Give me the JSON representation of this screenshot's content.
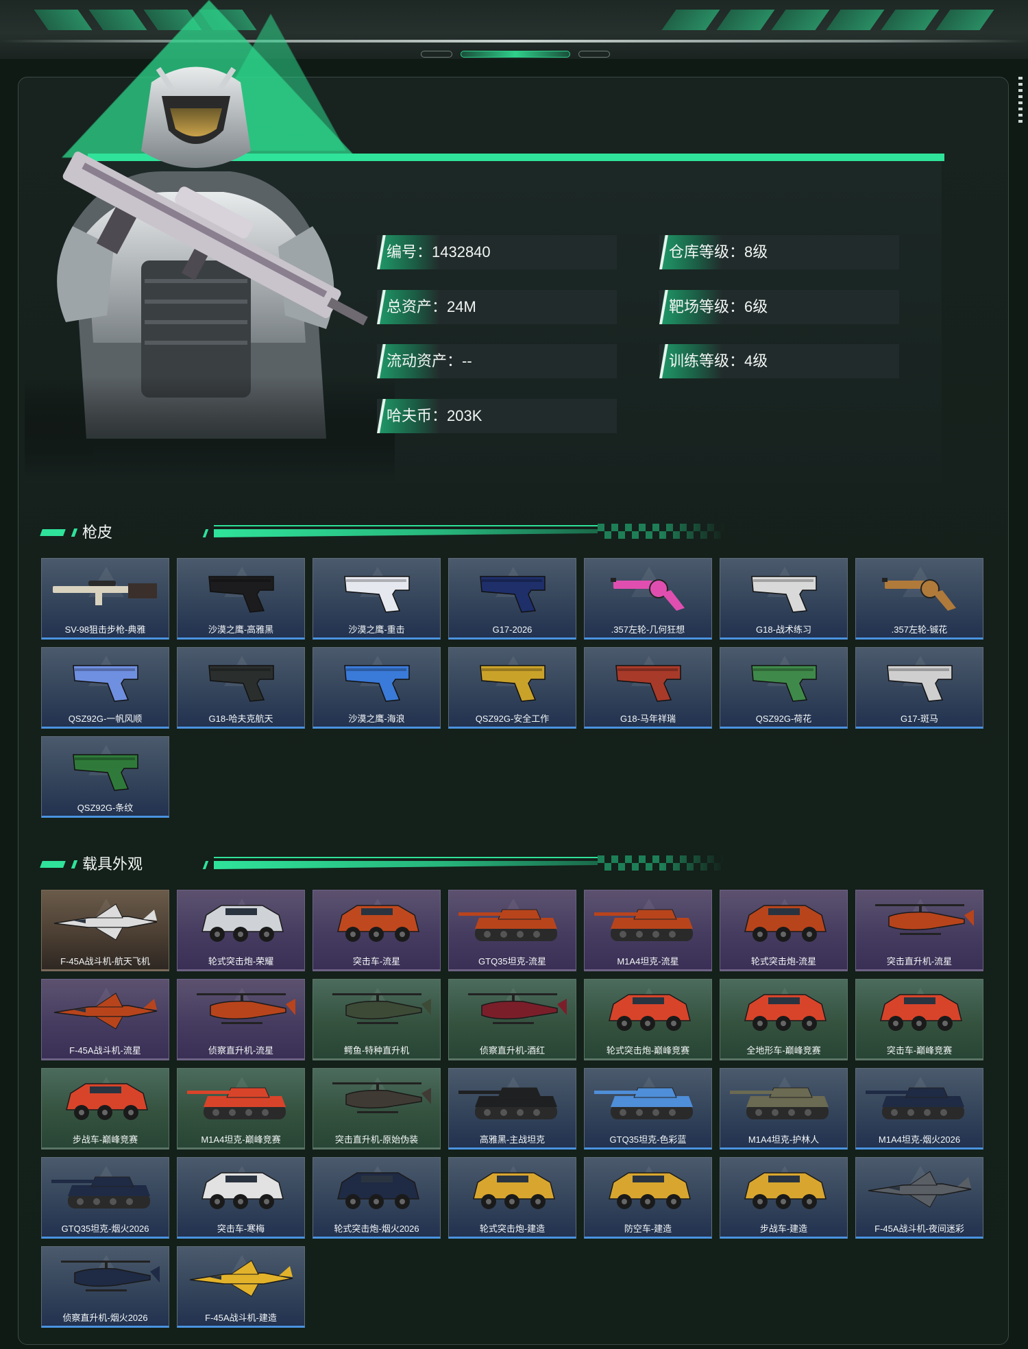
{
  "profile": {
    "stats": [
      {
        "text": "编号：1432840"
      },
      {
        "text": "仓库等级：8级"
      },
      {
        "text": "总资产：24M"
      },
      {
        "text": "靶场等级：6级"
      },
      {
        "text": "流动资产：--"
      },
      {
        "text": "训练等级：4级"
      },
      {
        "text": "哈夫币：203K"
      }
    ]
  },
  "weapon_skins": {
    "title": "枪皮",
    "items": [
      {
        "label": "SV-98狙击步枪-典雅",
        "rarity": "blue",
        "kind": "rifle",
        "color": "#d9d2bf"
      },
      {
        "label": "沙漠之鹰-高雅黑",
        "rarity": "blue",
        "kind": "pistol",
        "color": "#1c1c1e"
      },
      {
        "label": "沙漠之鹰-重击",
        "rarity": "blue",
        "kind": "pistol",
        "color": "#e6e8f0"
      },
      {
        "label": "G17-2026",
        "rarity": "blue",
        "kind": "pistol",
        "color": "#1e2f6a"
      },
      {
        "label": ".357左轮-几何狂想",
        "rarity": "blue",
        "kind": "revolver",
        "color": "#e04fb0"
      },
      {
        "label": "G18-战术练习",
        "rarity": "blue",
        "kind": "pistol",
        "color": "#d9d9d9"
      },
      {
        "label": ".357左轮-铖花",
        "rarity": "blue",
        "kind": "revolver",
        "color": "#b07a3a"
      },
      {
        "label": "QSZ92G-一帆风顺",
        "rarity": "blue",
        "kind": "pistol",
        "color": "#6f8fe0"
      },
      {
        "label": "G18-哈夫克航天",
        "rarity": "blue",
        "kind": "pistol",
        "color": "#2a2f2e"
      },
      {
        "label": "沙漠之鹰-海浪",
        "rarity": "blue",
        "kind": "pistol",
        "color": "#3a7ad8"
      },
      {
        "label": "QSZ92G-安全工作",
        "rarity": "blue",
        "kind": "pistol",
        "color": "#c9a22a"
      },
      {
        "label": "G18-马年祥瑞",
        "rarity": "blue",
        "kind": "pistol",
        "color": "#a83a2a"
      },
      {
        "label": "QSZ92G-荷花",
        "rarity": "blue",
        "kind": "pistol",
        "color": "#3f8a4a"
      },
      {
        "label": "G17-斑马",
        "rarity": "blue",
        "kind": "pistol",
        "color": "#cfcfcf"
      },
      {
        "label": "QSZ92G-条纹",
        "rarity": "blue",
        "kind": "pistol",
        "color": "#2f7a3a"
      }
    ]
  },
  "vehicle_skins": {
    "title": "载具外观",
    "items": [
      {
        "label": "F-45A战斗机-航天飞机",
        "rarity": "orange",
        "kind": "jet",
        "color": "#dcdcdc"
      },
      {
        "label": "轮式突击炮-荣耀",
        "rarity": "purple",
        "kind": "car",
        "color": "#cfd3d8"
      },
      {
        "label": "突击车-流星",
        "rarity": "purple",
        "kind": "car",
        "color": "#c0481e"
      },
      {
        "label": "GTQ35坦克-流星",
        "rarity": "purple",
        "kind": "tank",
        "color": "#b8441c"
      },
      {
        "label": "M1A4坦克-流星",
        "rarity": "purple",
        "kind": "tank",
        "color": "#b8441c"
      },
      {
        "label": "轮式突击炮-流星",
        "rarity": "purple",
        "kind": "car",
        "color": "#b8441c"
      },
      {
        "label": "突击直升机-流星",
        "rarity": "purple",
        "kind": "heli",
        "color": "#b8441c"
      },
      {
        "label": "F-45A战斗机-流星",
        "rarity": "purple",
        "kind": "jet",
        "color": "#b8441c"
      },
      {
        "label": "侦察直升机-流星",
        "rarity": "purple",
        "kind": "heli",
        "color": "#b8441c"
      },
      {
        "label": "鳄鱼-特种直升机",
        "rarity": "green",
        "kind": "heli",
        "color": "#3c4a36"
      },
      {
        "label": "侦察直升机-酒红",
        "rarity": "green",
        "kind": "heli",
        "color": "#7a1f2a"
      },
      {
        "label": "轮式突击炮-巅峰竞赛",
        "rarity": "green",
        "kind": "car",
        "color": "#d8442a"
      },
      {
        "label": "全地形车-巅峰竞赛",
        "rarity": "green",
        "kind": "car",
        "color": "#d8442a"
      },
      {
        "label": "突击车-巅峰竞赛",
        "rarity": "green",
        "kind": "car",
        "color": "#d8442a"
      },
      {
        "label": "步战车-巅峰竞赛",
        "rarity": "green",
        "kind": "car",
        "color": "#d8442a"
      },
      {
        "label": "M1A4坦克-巅峰竞赛",
        "rarity": "green",
        "kind": "tank",
        "color": "#d8442a"
      },
      {
        "label": "突击直升机-原始伪装",
        "rarity": "green",
        "kind": "heli",
        "color": "#3f3a33"
      },
      {
        "label": "高雅黑-主战坦克",
        "rarity": "blue",
        "kind": "tank",
        "color": "#1f2022"
      },
      {
        "label": "GTQ35坦克-色彩蓝",
        "rarity": "blue",
        "kind": "tank",
        "color": "#4f8ed8"
      },
      {
        "label": "M1A4坦克-护林人",
        "rarity": "blue",
        "kind": "tank",
        "color": "#6b6a52"
      },
      {
        "label": "M1A4坦克-烟火2026",
        "rarity": "blue",
        "kind": "tank",
        "color": "#1f2a44"
      },
      {
        "label": "GTQ35坦克-烟火2026",
        "rarity": "blue",
        "kind": "tank",
        "color": "#1f2a44"
      },
      {
        "label": "突击车-寒梅",
        "rarity": "blue",
        "kind": "car",
        "color": "#e2e2e2"
      },
      {
        "label": "轮式突击炮-烟火2026",
        "rarity": "blue",
        "kind": "car",
        "color": "#1f2a44"
      },
      {
        "label": "轮式突击炮-建造",
        "rarity": "blue",
        "kind": "car",
        "color": "#d8a62f"
      },
      {
        "label": "防空车-建造",
        "rarity": "blue",
        "kind": "car",
        "color": "#d8a62f"
      },
      {
        "label": "步战车-建造",
        "rarity": "blue",
        "kind": "car",
        "color": "#d8a62f"
      },
      {
        "label": "F-45A战斗机-夜间迷彩",
        "rarity": "blue",
        "kind": "jet",
        "color": "#5a5f66"
      },
      {
        "label": "侦察直升机-烟火2026",
        "rarity": "blue",
        "kind": "heli",
        "color": "#1f2a44"
      },
      {
        "label": "F-45A战斗机-建造",
        "rarity": "blue",
        "kind": "jet",
        "color": "#e2b22a"
      }
    ]
  },
  "theme": {
    "accent": "#2fe39a",
    "rarity_blue": "#4a93e0",
    "rarity_purple": "#a775e8",
    "rarity_green": "#3fd88e",
    "rarity_orange": "#e0862f"
  }
}
